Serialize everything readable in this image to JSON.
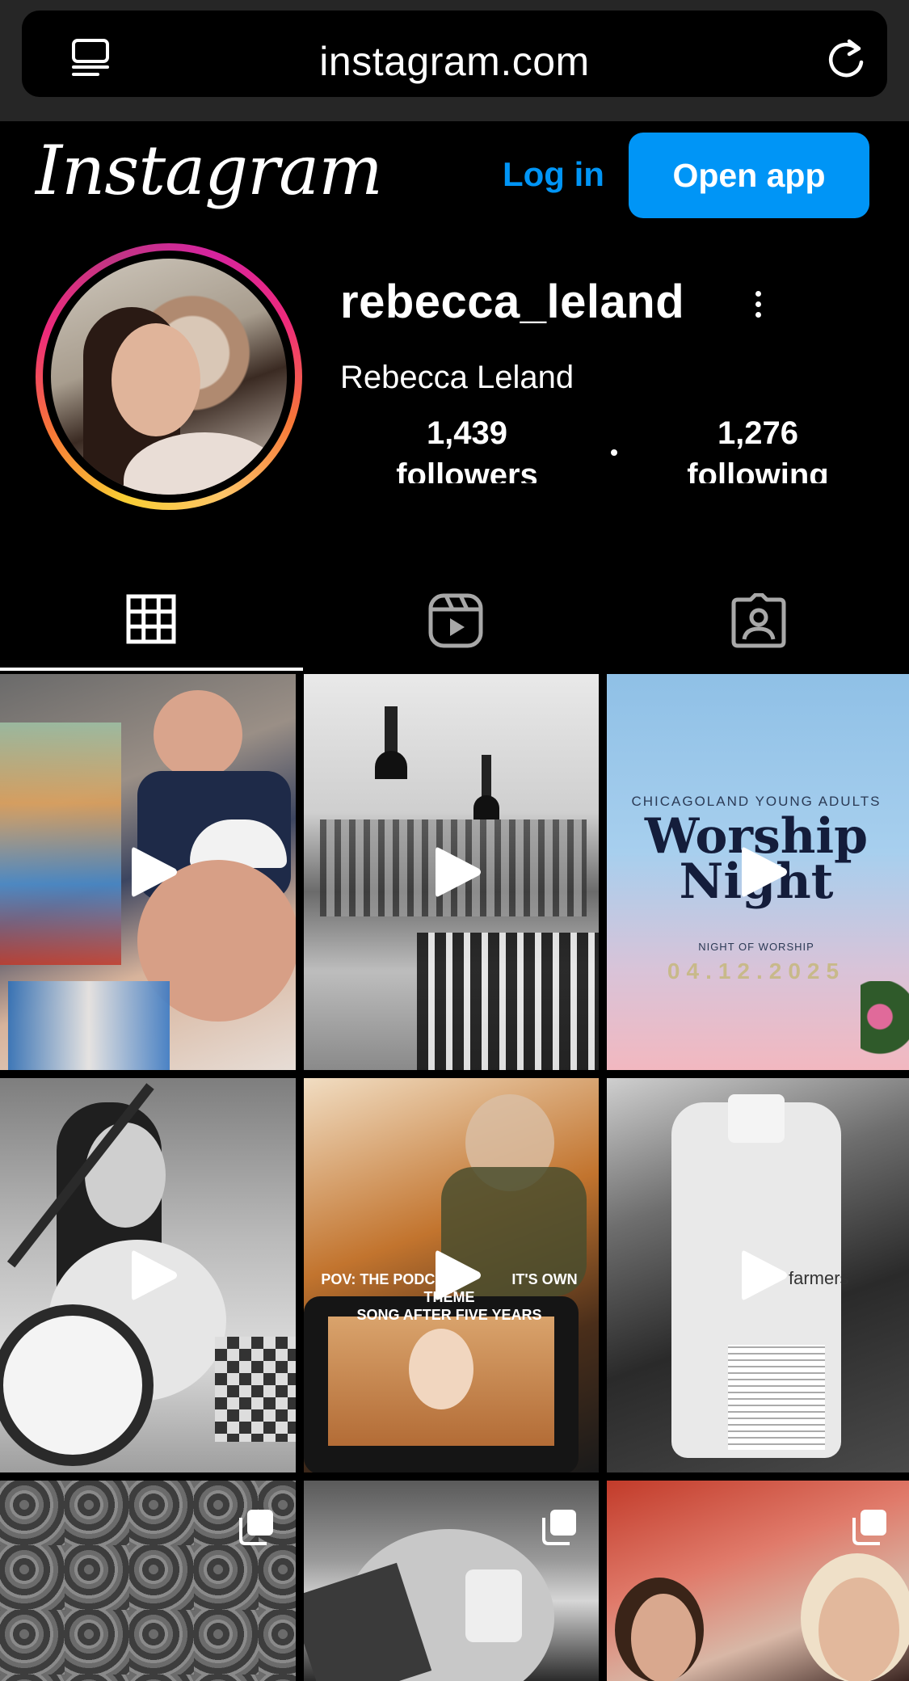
{
  "browser": {
    "url": "instagram.com"
  },
  "header": {
    "logo_text": "Instagram",
    "login_label": "Log in",
    "open_app_label": "Open app"
  },
  "profile": {
    "username": "rebecca_leland",
    "full_name": "Rebecca Leland",
    "followers_count": "1,439",
    "followers_label": "followers",
    "following_count": "1,276",
    "following_label": "following"
  },
  "tabs": [
    {
      "name": "posts",
      "icon": "grid-icon",
      "active": true
    },
    {
      "name": "reels",
      "icon": "reels-icon",
      "active": false
    },
    {
      "name": "tagged",
      "icon": "tagged-icon",
      "active": false
    }
  ],
  "posts": [
    {
      "type": "reel"
    },
    {
      "type": "reel"
    },
    {
      "type": "reel",
      "overlay": {
        "line1": "CHICAGOLAND YOUNG ADULTS",
        "line2": "Worship",
        "line3": "Night",
        "line4": "NIGHT OF WORSHIP",
        "line5": "04.12.2025"
      }
    },
    {
      "type": "reel"
    },
    {
      "type": "reel",
      "overlay": {
        "line1": "POV: THE PODCAS",
        "line1b": "IT'S OWN THEME",
        "line2": "SONG AFTER FIVE YEARS"
      }
    },
    {
      "type": "reel",
      "overlay": {
        "line1": "farmers"
      }
    },
    {
      "type": "carousel"
    },
    {
      "type": "carousel"
    },
    {
      "type": "carousel"
    }
  ],
  "colors": {
    "accent": "#0095f6",
    "background": "#000000",
    "browser_bar": "#262626"
  }
}
